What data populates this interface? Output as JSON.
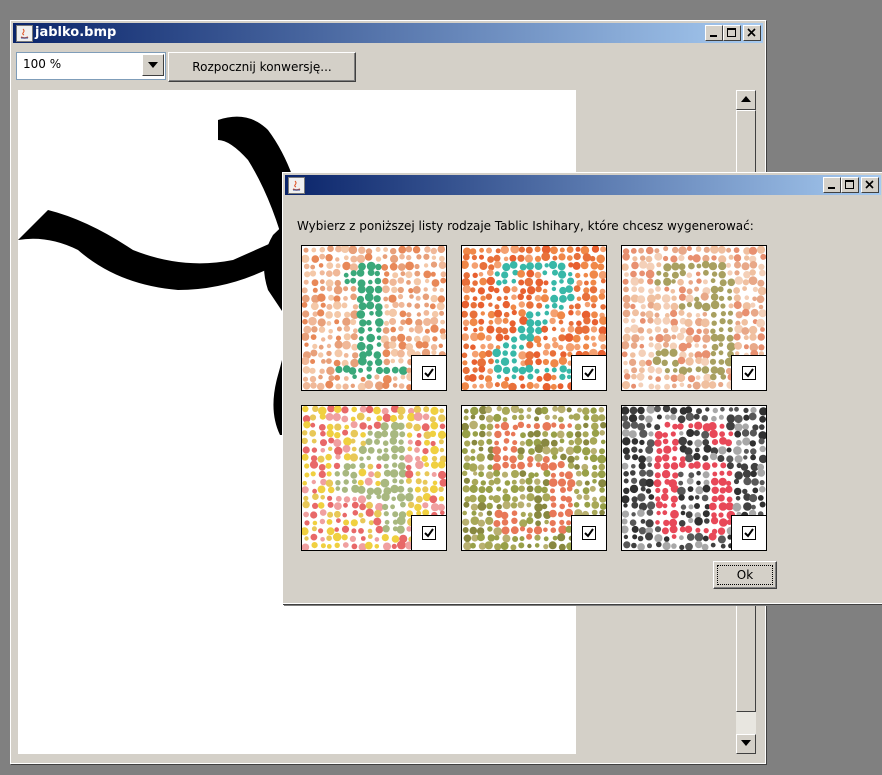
{
  "main_window": {
    "title": "jablko.bmp",
    "zoom_value": "100 %",
    "convert_button": "Rozpocznij konwersję..."
  },
  "dialog": {
    "title": "",
    "prompt": "Wybierz z poniższej listy rodzaje Tablic Ishihary, które chcesz wygenerować:",
    "ok_button": "Ok",
    "plates": [
      {
        "numeral": "1",
        "checked": true,
        "bg": [
          "#e8a07a",
          "#f0b898",
          "#e88858",
          "#f4c8a8"
        ],
        "fg": "#3aa87a"
      },
      {
        "numeral": "2",
        "checked": true,
        "bg": [
          "#e8703a",
          "#f08848",
          "#f4a070",
          "#e86030"
        ],
        "fg": "#38b8a8"
      },
      {
        "numeral": "3",
        "checked": true,
        "bg": [
          "#e8a888",
          "#f0c0a0",
          "#e89070",
          "#f4d0b8"
        ],
        "fg": "#a8a060"
      },
      {
        "numeral": "4",
        "checked": true,
        "bg": [
          "#e86868",
          "#f0d040",
          "#e8c858",
          "#f0a0a0"
        ],
        "fg": "#a8b880"
      },
      {
        "numeral": "5",
        "checked": true,
        "bg": [
          "#98a048",
          "#a8a858",
          "#888840",
          "#b8b070"
        ],
        "fg": "#e87858"
      },
      {
        "numeral": "6",
        "checked": true,
        "bg": [
          "#404040",
          "#585858",
          "#a8a8a8",
          "#303030"
        ],
        "fg": "#e84858"
      }
    ]
  },
  "colors": {
    "title_start": "#0a246a",
    "title_end": "#a6caf0",
    "window_bg": "#d4d0c8",
    "desktop": "#808080"
  }
}
